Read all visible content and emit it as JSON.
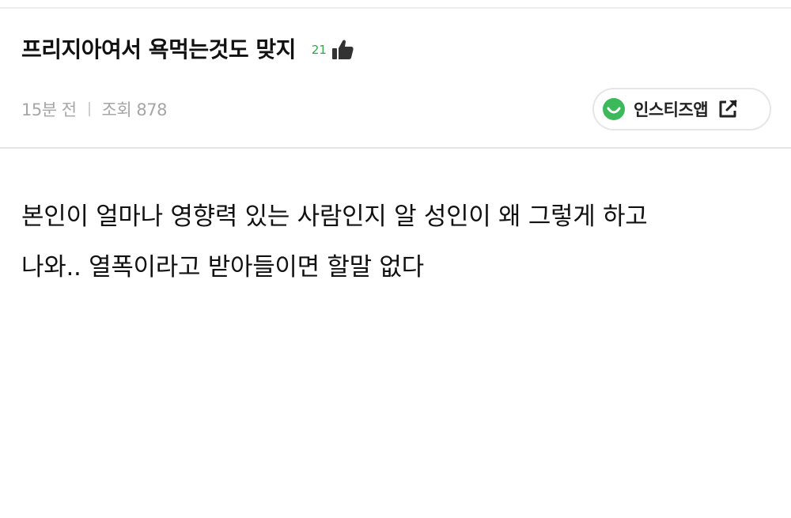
{
  "post": {
    "title": "프리지아여서 욕먹는것도 맞지",
    "like_count": "21",
    "meta": {
      "time": "15분 전",
      "views": "조회 878"
    },
    "body_lines": [
      "본인이 얼마나 영향력 있는 사람인지 알 성인이 왜 그렇게 하고",
      "나와.. 열폭이라고 받아들이면 할말 없다"
    ]
  },
  "app_button": {
    "label": "인스티즈앱",
    "icon_left": "smile-icon",
    "icon_right": "external-link-icon"
  },
  "colors": {
    "accent_green": "#2fa84f",
    "meta_gray": "#a6a6a6",
    "title": "#111111"
  }
}
